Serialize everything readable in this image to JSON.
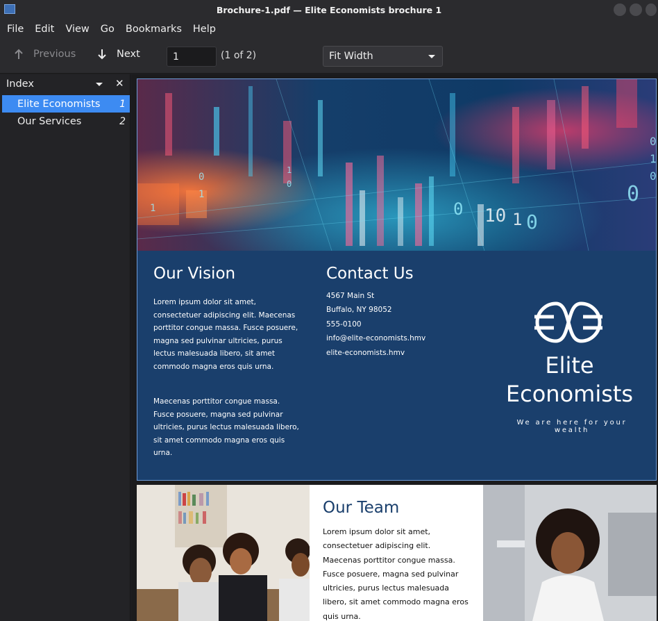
{
  "window": {
    "title": "Brochure-1.pdf — Elite Economists brochure 1"
  },
  "menu": [
    "File",
    "Edit",
    "View",
    "Go",
    "Bookmarks",
    "Help"
  ],
  "toolbar": {
    "previous_label": "Previous",
    "next_label": "Next",
    "page_value": "1",
    "page_count": "(1 of 2)",
    "zoom_value": "Fit Width"
  },
  "sidebar": {
    "header": "Index",
    "close_glyph": "✕",
    "items": [
      {
        "label": "Elite Economists",
        "page": "1",
        "active": true
      },
      {
        "label": "Our Services",
        "page": "2",
        "active": false
      }
    ]
  },
  "document": {
    "page1": {
      "vision_title": "Our Vision",
      "vision_p1": "Lorem ipsum dolor sit amet, consectetuer adipiscing elit. Maecenas porttitor congue massa. Fusce posuere, magna sed pulvinar ultricies, purus lectus malesuada libero, sit amet commodo magna eros quis urna.",
      "vision_p2": "Maecenas porttitor congue massa. Fusce posuere, magna sed pulvinar ultricies, purus lectus malesuada libero, sit amet commodo magna eros quis urna.",
      "contact_title": "Contact Us",
      "contact_lines": [
        "4567 Main St",
        "Buffalo, NY 98052",
        "555-0100",
        "info@elite-economists.hmv",
        "elite-economists.hmv"
      ],
      "brand_name": "Elite Economists",
      "tagline": "We are here for your wealth"
    },
    "page2": {
      "team_title": "Our Team",
      "team_p": "Lorem ipsum dolor sit amet, consectetuer adipiscing elit. Maecenas porttitor congue massa. Fusce posuere, magna sed pulvinar ultricies, purus lectus malesuada libero, sit amet commodo magna eros quis urna."
    }
  },
  "colors": {
    "accent": "#3d8bf2",
    "brochure_blue": "#1a3f6c"
  }
}
